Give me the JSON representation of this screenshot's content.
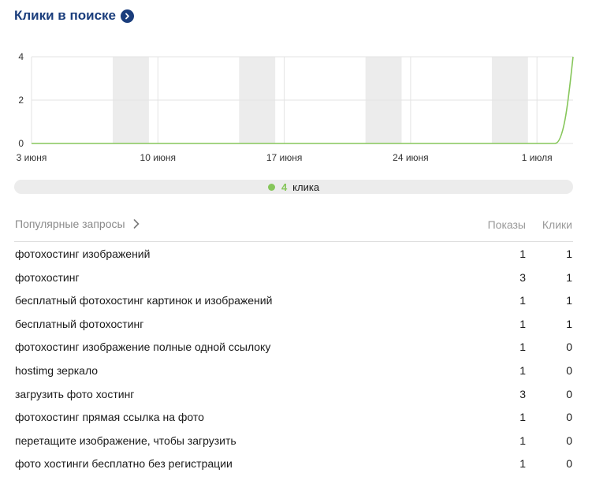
{
  "header": {
    "title": "Клики в поиске"
  },
  "chart_data": {
    "type": "line",
    "y_ticks": [
      "0",
      "2",
      "4"
    ],
    "ylim": [
      0,
      4
    ],
    "x_tick_labels": [
      "3 июня",
      "10 июня",
      "17 июня",
      "24 июня",
      "1 июля"
    ],
    "series": [
      {
        "name": "клика",
        "color": "#86c65a",
        "x": [
          "3 июня",
          "4 июня",
          "5 июня",
          "6 июня",
          "7 июня",
          "8 июня",
          "9 июня",
          "10 июня",
          "11 июня",
          "12 июня",
          "13 июня",
          "14 июня",
          "15 июня",
          "16 июня",
          "17 июня",
          "18 июня",
          "19 июня",
          "20 июня",
          "21 июня",
          "22 июня",
          "23 июня",
          "24 июня",
          "25 июня",
          "26 июня",
          "27 июня",
          "28 июня",
          "29 июня",
          "30 июня",
          "1 июля",
          "2 июля",
          "3 июля"
        ],
        "values": [
          0,
          0,
          0,
          0,
          0,
          0,
          0,
          0,
          0,
          0,
          0,
          0,
          0,
          0,
          0,
          0,
          0,
          0,
          0,
          0,
          0,
          0,
          0,
          0,
          0,
          0,
          0,
          0,
          0,
          0,
          4
        ]
      }
    ],
    "grid": true,
    "weekend_shading_color": "#ececec"
  },
  "legend": {
    "value": "4",
    "label": "клика",
    "color": "#86c65a"
  },
  "table": {
    "query_header": "Популярные запросы",
    "shows_header": "Показы",
    "clicks_header": "Клики",
    "rows": [
      {
        "query": "фотохостинг изображений",
        "shows": "1",
        "clicks": "1"
      },
      {
        "query": "фотохостинг",
        "shows": "3",
        "clicks": "1"
      },
      {
        "query": "бесплатный фотохостинг картинок и изображений",
        "shows": "1",
        "clicks": "1"
      },
      {
        "query": "бесплатный фотохостинг",
        "shows": "1",
        "clicks": "1"
      },
      {
        "query": "фотохостинг изображение полные одной ссылоку",
        "shows": "1",
        "clicks": "0"
      },
      {
        "query": "hostimg зеркало",
        "shows": "1",
        "clicks": "0"
      },
      {
        "query": "загрузить фото хостинг",
        "shows": "3",
        "clicks": "0"
      },
      {
        "query": "фотохостинг прямая ссылка на фото",
        "shows": "1",
        "clicks": "0"
      },
      {
        "query": "перетащите изображение, чтобы загрузить",
        "shows": "1",
        "clicks": "0"
      },
      {
        "query": "фото хостинги бесплатно без регистрации",
        "shows": "1",
        "clicks": "0"
      }
    ]
  }
}
